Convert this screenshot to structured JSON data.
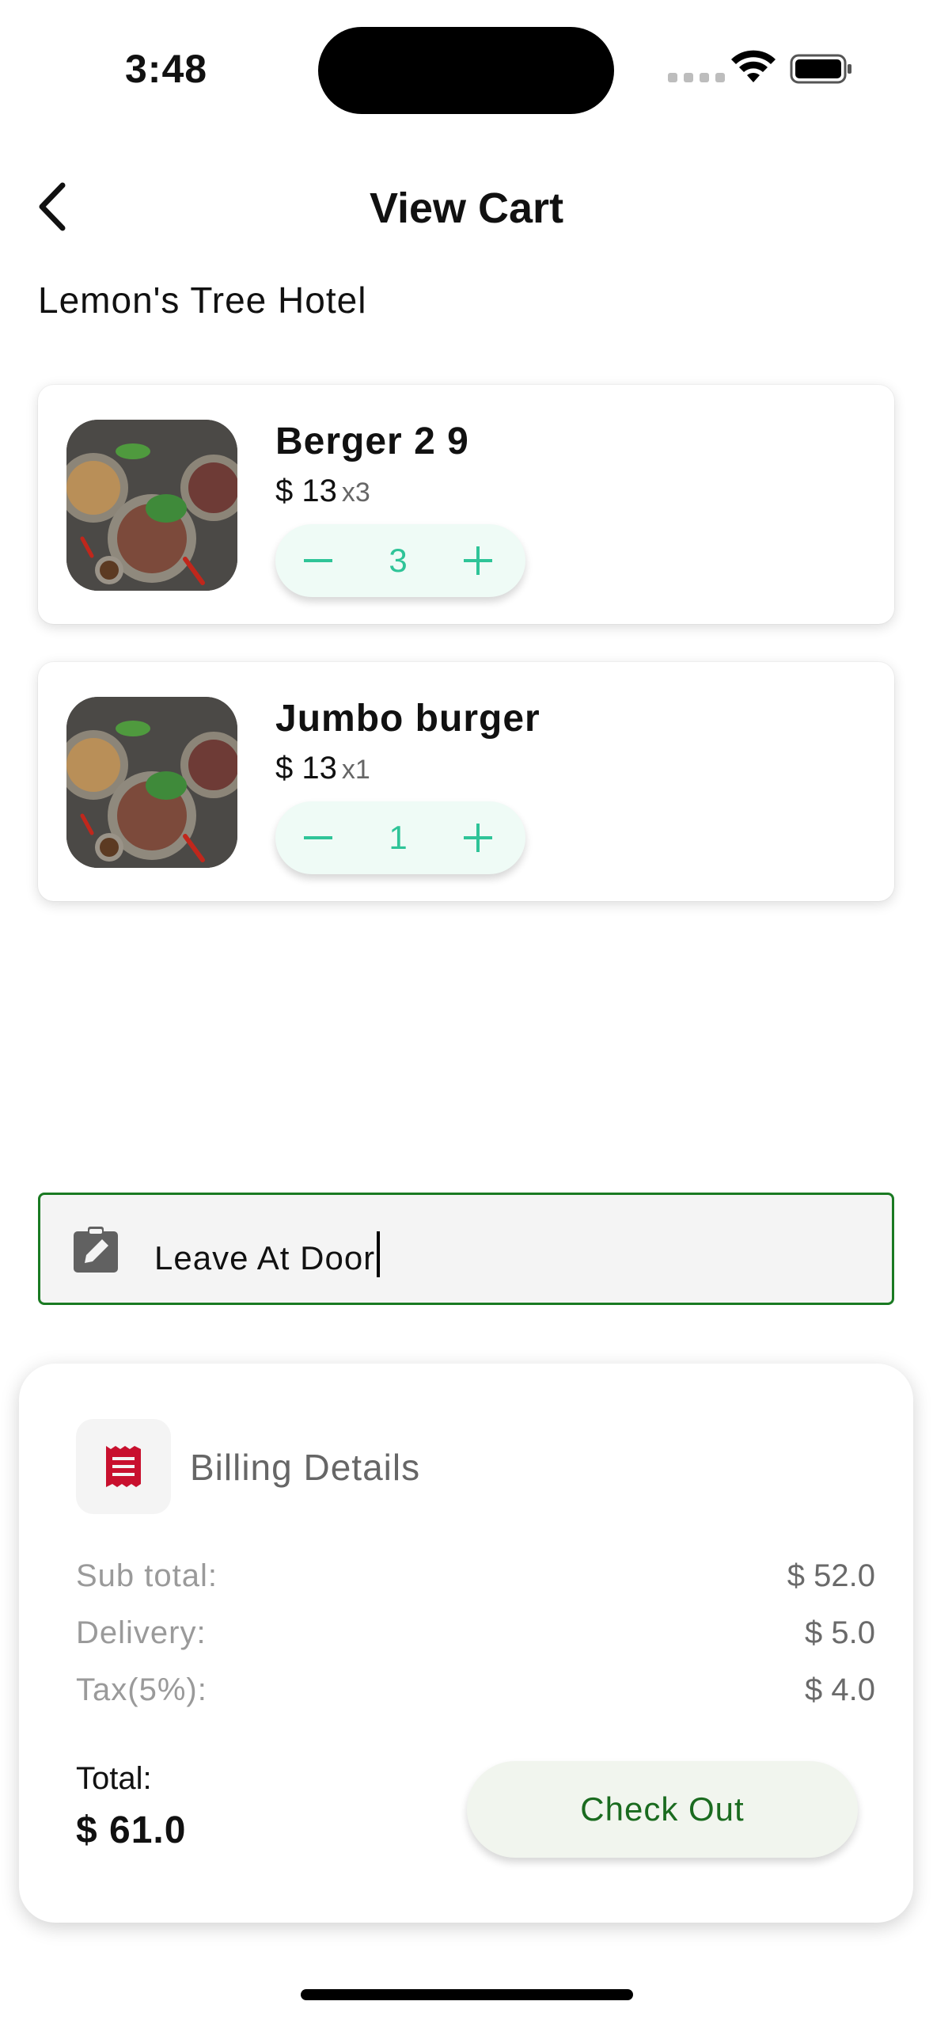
{
  "status_bar": {
    "time": "3:48"
  },
  "header": {
    "title": "View Cart"
  },
  "restaurant": {
    "name": "Lemon's Tree Hotel"
  },
  "cart_items": [
    {
      "name": "Berger 2 9",
      "price": "$ 13",
      "multiplier": "x3",
      "quantity": "3"
    },
    {
      "name": "Jumbo burger",
      "price": "$ 13",
      "multiplier": "x1",
      "quantity": "1"
    }
  ],
  "note": {
    "value": "Leave At Door"
  },
  "billing": {
    "title": "Billing Details",
    "rows": [
      {
        "label": "Sub total:",
        "value": "$ 52.0"
      },
      {
        "label": "Delivery:",
        "value": "$ 5.0"
      },
      {
        "label": "Tax(5%):",
        "value": "$ 4.0"
      }
    ],
    "total_label": "Total:",
    "total_value": "$ 61.0",
    "checkout_label": "Check Out"
  },
  "colors": {
    "accent_green": "#2fc498",
    "checkout_text": "#1a6b1f",
    "note_border": "#1a7a22",
    "bill_icon": "#c8102e"
  }
}
